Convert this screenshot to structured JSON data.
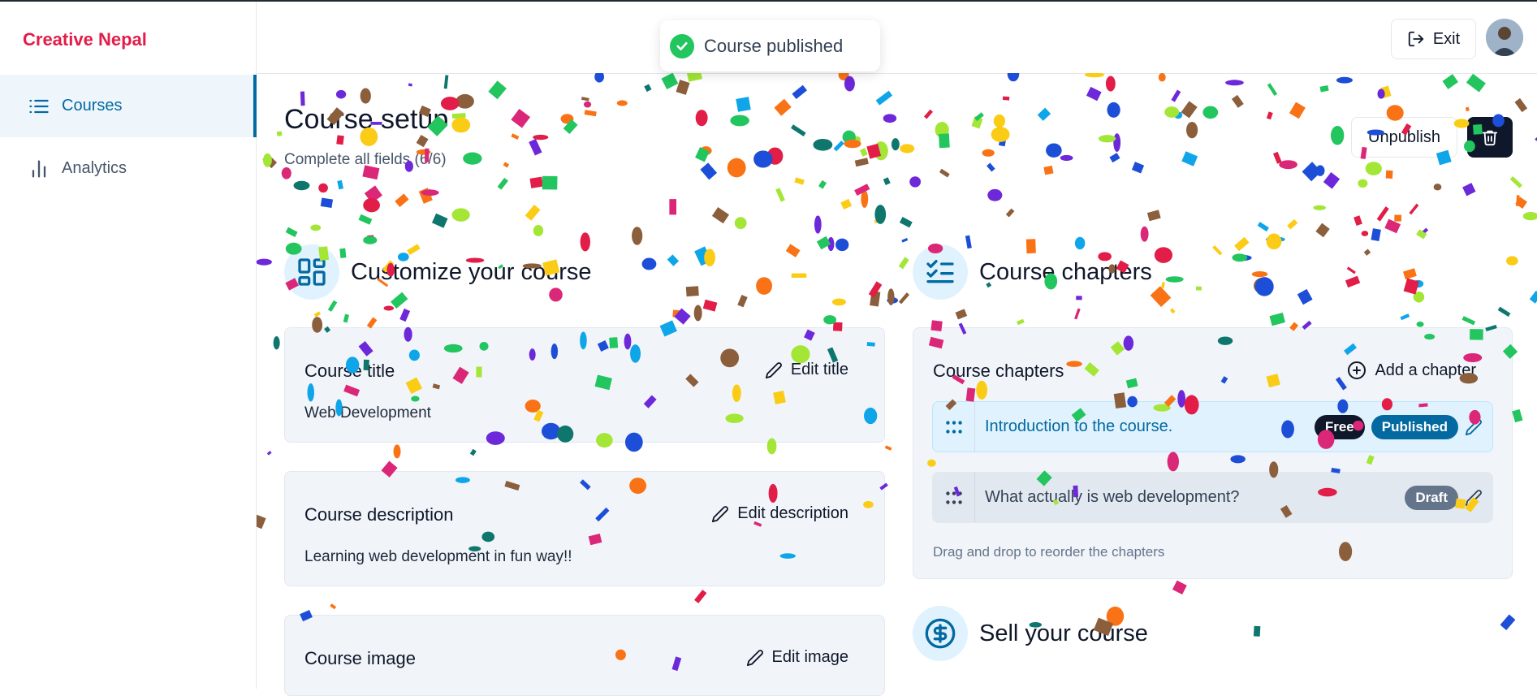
{
  "app": {
    "brand": "Creative Nepal"
  },
  "sidebar": {
    "items": [
      {
        "label": "Courses",
        "icon": "list-icon"
      },
      {
        "label": "Analytics",
        "icon": "bar-chart-icon"
      }
    ]
  },
  "header": {
    "exit_label": "Exit"
  },
  "toast": {
    "message": "Course published"
  },
  "page": {
    "title": "Course setup",
    "subtitle": "Complete all fields (6/6)",
    "unpublish_label": "Unpublish"
  },
  "customize": {
    "heading": "Customize your course",
    "cards": [
      {
        "label": "Course title",
        "action": "Edit title",
        "value": "Web Development"
      },
      {
        "label": "Course description",
        "action": "Edit description",
        "value": "Learning web development in fun way!!"
      },
      {
        "label": "Course image",
        "action": "Edit image"
      }
    ]
  },
  "chapters": {
    "heading": "Course chapters",
    "card_label": "Course chapters",
    "add_label": "Add a chapter",
    "items": [
      {
        "title": "Introduction to the course.",
        "badges": [
          "Free",
          "Published"
        ]
      },
      {
        "title": "What actually is web development?",
        "badges": [
          "Draft"
        ]
      }
    ],
    "hint": "Drag and drop to reorder the chapters"
  },
  "sell": {
    "heading": "Sell your course"
  },
  "colors": {
    "brand": "#e11d48",
    "accent": "#0369a1",
    "success": "#22c55e",
    "dark": "#0f172a"
  }
}
